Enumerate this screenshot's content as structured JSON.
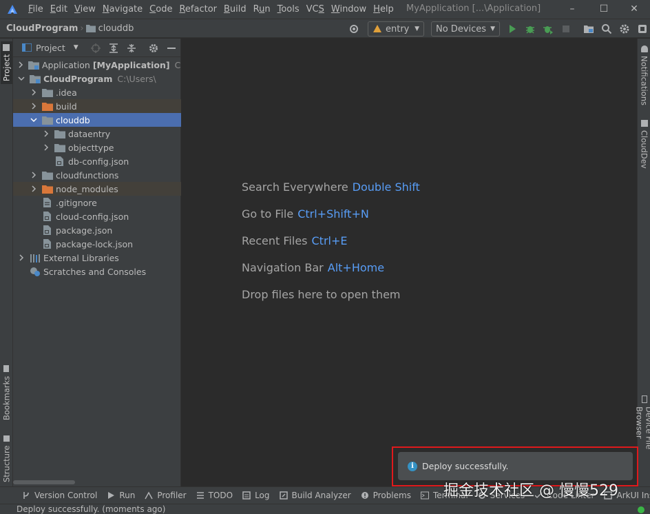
{
  "menubar": {
    "items": [
      {
        "label": "File",
        "mnemonic": "F"
      },
      {
        "label": "Edit",
        "mnemonic": "E"
      },
      {
        "label": "View",
        "mnemonic": "V"
      },
      {
        "label": "Navigate",
        "mnemonic": "N"
      },
      {
        "label": "Code",
        "mnemonic": "C"
      },
      {
        "label": "Refactor",
        "mnemonic": "R"
      },
      {
        "label": "Build",
        "mnemonic": "B"
      },
      {
        "label": "Run",
        "mnemonic": "u"
      },
      {
        "label": "Tools",
        "mnemonic": "T"
      },
      {
        "label": "VCS",
        "mnemonic": "S"
      },
      {
        "label": "Window",
        "mnemonic": "W"
      },
      {
        "label": "Help",
        "mnemonic": "H"
      }
    ],
    "window_title": "MyApplication [...\\Application]"
  },
  "navbar": {
    "project": "CloudProgram",
    "folder": "clouddb",
    "run_config": "entry",
    "device": "No Devices"
  },
  "left_tabs": {
    "project": "Project",
    "bookmarks": "Bookmarks",
    "structure": "Structure"
  },
  "right_tabs": {
    "notifications": "Notifications",
    "clouddev": "CloudDev",
    "device_file_browser": "Device File Browser"
  },
  "project_panel": {
    "title": "Project",
    "tree": [
      {
        "label": "Application",
        "bold": "[MyApplication]",
        "hint": "C:\\U",
        "depth": 0,
        "expand": "collapsed",
        "icon": "module-folder"
      },
      {
        "label": "CloudProgram",
        "hint": "C:\\Users\\",
        "depth": 0,
        "expand": "expanded",
        "icon": "module-folder",
        "bold_label": true
      },
      {
        "label": ".idea",
        "depth": 1,
        "expand": "collapsed",
        "icon": "folder"
      },
      {
        "label": "build",
        "depth": 1,
        "expand": "collapsed",
        "icon": "excluded-folder",
        "state": "excluded"
      },
      {
        "label": "clouddb",
        "depth": 1,
        "expand": "expanded",
        "icon": "folder",
        "state": "selected"
      },
      {
        "label": "dataentry",
        "depth": 2,
        "expand": "collapsed",
        "icon": "folder"
      },
      {
        "label": "objecttype",
        "depth": 2,
        "expand": "collapsed",
        "icon": "folder"
      },
      {
        "label": "db-config.json",
        "depth": 2,
        "expand": "none",
        "icon": "json-file"
      },
      {
        "label": "cloudfunctions",
        "depth": 1,
        "expand": "collapsed",
        "icon": "folder"
      },
      {
        "label": "node_modules",
        "depth": 1,
        "expand": "collapsed",
        "icon": "excluded-folder",
        "state": "excluded"
      },
      {
        "label": ".gitignore",
        "depth": 1,
        "expand": "none",
        "icon": "text-file"
      },
      {
        "label": "cloud-config.json",
        "depth": 1,
        "expand": "none",
        "icon": "json-file"
      },
      {
        "label": "package.json",
        "depth": 1,
        "expand": "none",
        "icon": "json-file"
      },
      {
        "label": "package-lock.json",
        "depth": 1,
        "expand": "none",
        "icon": "json-file"
      },
      {
        "label": "External Libraries",
        "depth": 0,
        "expand": "collapsed",
        "icon": "library"
      },
      {
        "label": "Scratches and Consoles",
        "depth": 0,
        "expand": "none",
        "icon": "scratches"
      }
    ]
  },
  "editor": {
    "tips": [
      {
        "text": "Search Everywhere",
        "key": "Double Shift"
      },
      {
        "text": "Go to File",
        "key": "Ctrl+Shift+N"
      },
      {
        "text": "Recent Files",
        "key": "Ctrl+E"
      },
      {
        "text": "Navigation Bar",
        "key": "Alt+Home"
      },
      {
        "text": "Drop files here to open them",
        "key": ""
      }
    ]
  },
  "notification": {
    "message": "Deploy successfully."
  },
  "bottom_tools": [
    {
      "label": "Version Control",
      "icon": "branch-icon"
    },
    {
      "label": "Run",
      "icon": "run-icon"
    },
    {
      "label": "Profiler",
      "icon": "profiler-icon"
    },
    {
      "label": "TODO",
      "icon": "todo-icon"
    },
    {
      "label": "Log",
      "icon": "log-icon"
    },
    {
      "label": "Build Analyzer",
      "icon": "build-analyzer-icon"
    },
    {
      "label": "Problems",
      "icon": "problems-icon"
    },
    {
      "label": "Terminal",
      "icon": "terminal-icon"
    },
    {
      "label": "Services",
      "icon": "services-icon"
    },
    {
      "label": "Code Linter",
      "icon": "linter-icon"
    },
    {
      "label": "ArkUI Insp",
      "icon": "inspector-icon"
    }
  ],
  "status": {
    "message": "Deploy successfully. (moments ago)"
  },
  "watermark": "掘金技术社区 @ 慢慢529",
  "colors": {
    "accent": "#589df6",
    "selection": "#4b6eaf",
    "run_green": "#499c54",
    "folder_orange": "#d9773a",
    "notif_border": "#e0191c"
  }
}
